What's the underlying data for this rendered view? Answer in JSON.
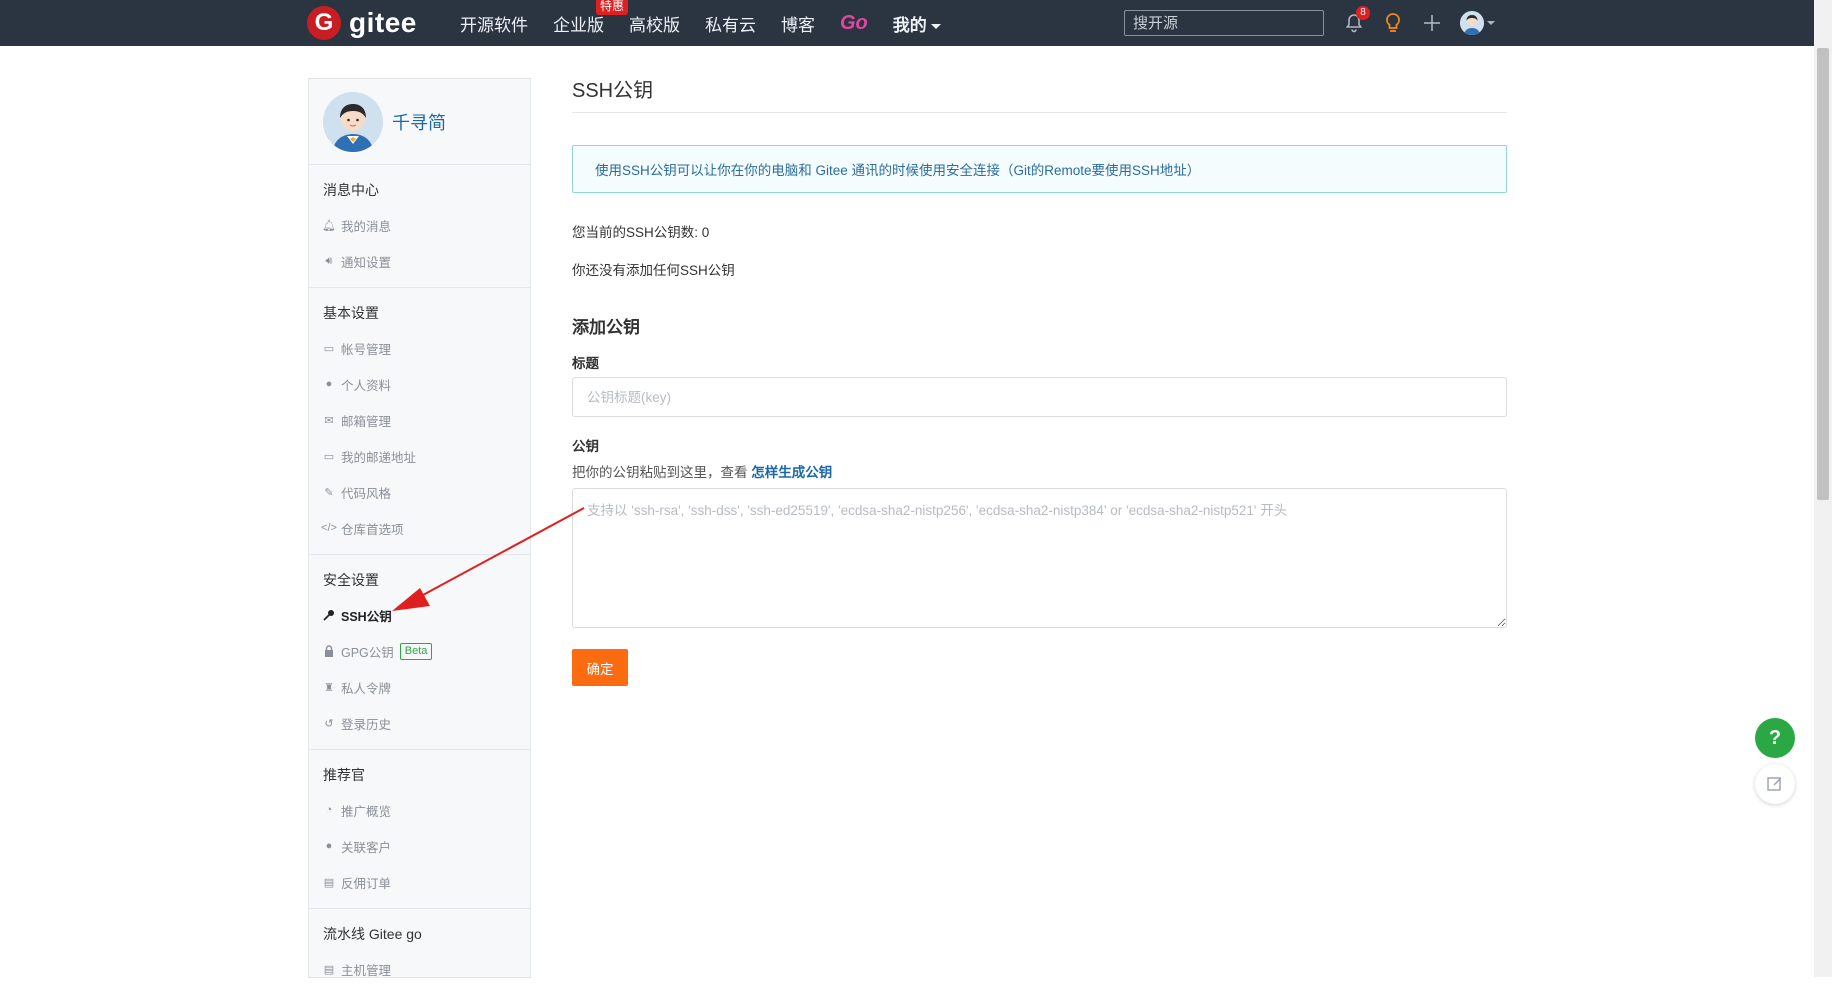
{
  "header": {
    "logo_text": "gitee",
    "logo_mark": "G",
    "nav": [
      "开源软件",
      "企业版",
      "高校版",
      "私有云",
      "博客",
      "Go",
      "我的"
    ],
    "hot_badge": "特惠",
    "search_placeholder": "搜开源",
    "notification_count": "8",
    "icons": [
      "bell-icon",
      "lightbulb-icon",
      "plus-icon",
      "avatar"
    ]
  },
  "sidebar": {
    "username": "千寻简",
    "sections": [
      {
        "title": "消息中心",
        "items": [
          {
            "label": "我的消息",
            "icon": "bell-icon"
          },
          {
            "label": "通知设置",
            "icon": "volume-icon"
          }
        ]
      },
      {
        "title": "基本设置",
        "items": [
          {
            "label": "帐号管理",
            "icon": "id-card-icon"
          },
          {
            "label": "个人资料",
            "icon": "user-icon"
          },
          {
            "label": "邮箱管理",
            "icon": "mail-icon"
          },
          {
            "label": "我的邮递地址",
            "icon": "id-card-icon"
          },
          {
            "label": "代码风格",
            "icon": "brush-icon"
          },
          {
            "label": "仓库首选项",
            "icon": "code-icon"
          }
        ]
      },
      {
        "title": "安全设置",
        "items": [
          {
            "label": "SSH公钥",
            "icon": "key-icon",
            "active": true
          },
          {
            "label": "GPG公钥",
            "icon": "lock-icon",
            "badge": "Beta"
          },
          {
            "label": "私人令牌",
            "icon": "token-icon"
          },
          {
            "label": "登录历史",
            "icon": "history-icon"
          }
        ]
      },
      {
        "title": "推荐官",
        "items": [
          {
            "label": "推广概览",
            "icon": "gauge-icon"
          },
          {
            "label": "关联客户",
            "icon": "user-link-icon"
          },
          {
            "label": "反佣订单",
            "icon": "order-icon"
          }
        ]
      },
      {
        "title": "流水线 Gitee go",
        "items": [
          {
            "label": "主机管理",
            "icon": "server-icon"
          }
        ]
      }
    ]
  },
  "main": {
    "title": "SSH公钥",
    "info": "使用SSH公钥可以让你在你的电脑和 Gitee 通讯的时候使用安全连接（Git的Remote要使用SSH地址）",
    "count_text": "您当前的SSH公钥数: 0",
    "empty_text": "你还没有添加任何SSH公钥",
    "add_title": "添加公钥",
    "title_label": "标题",
    "title_placeholder": "公钥标题(key)",
    "key_label": "公钥",
    "key_hint": "把你的公钥粘贴到这里，查看 ",
    "key_hint_link": "怎样生成公钥",
    "key_placeholder": "支持以 'ssh-rsa', 'ssh-dss', 'ssh-ed25519', 'ecdsa-sha2-nistp256', 'ecdsa-sha2-nistp384' or 'ecdsa-sha2-nistp521' 开头",
    "submit_label": "确定"
  },
  "floating": {
    "help": "?"
  },
  "colors": {
    "navbar": "#2b3441",
    "brand": "#c71d23",
    "accent": "#fb6b0f",
    "link": "#1a68a8",
    "help": "#2aa843",
    "annotation": "#e02020"
  }
}
